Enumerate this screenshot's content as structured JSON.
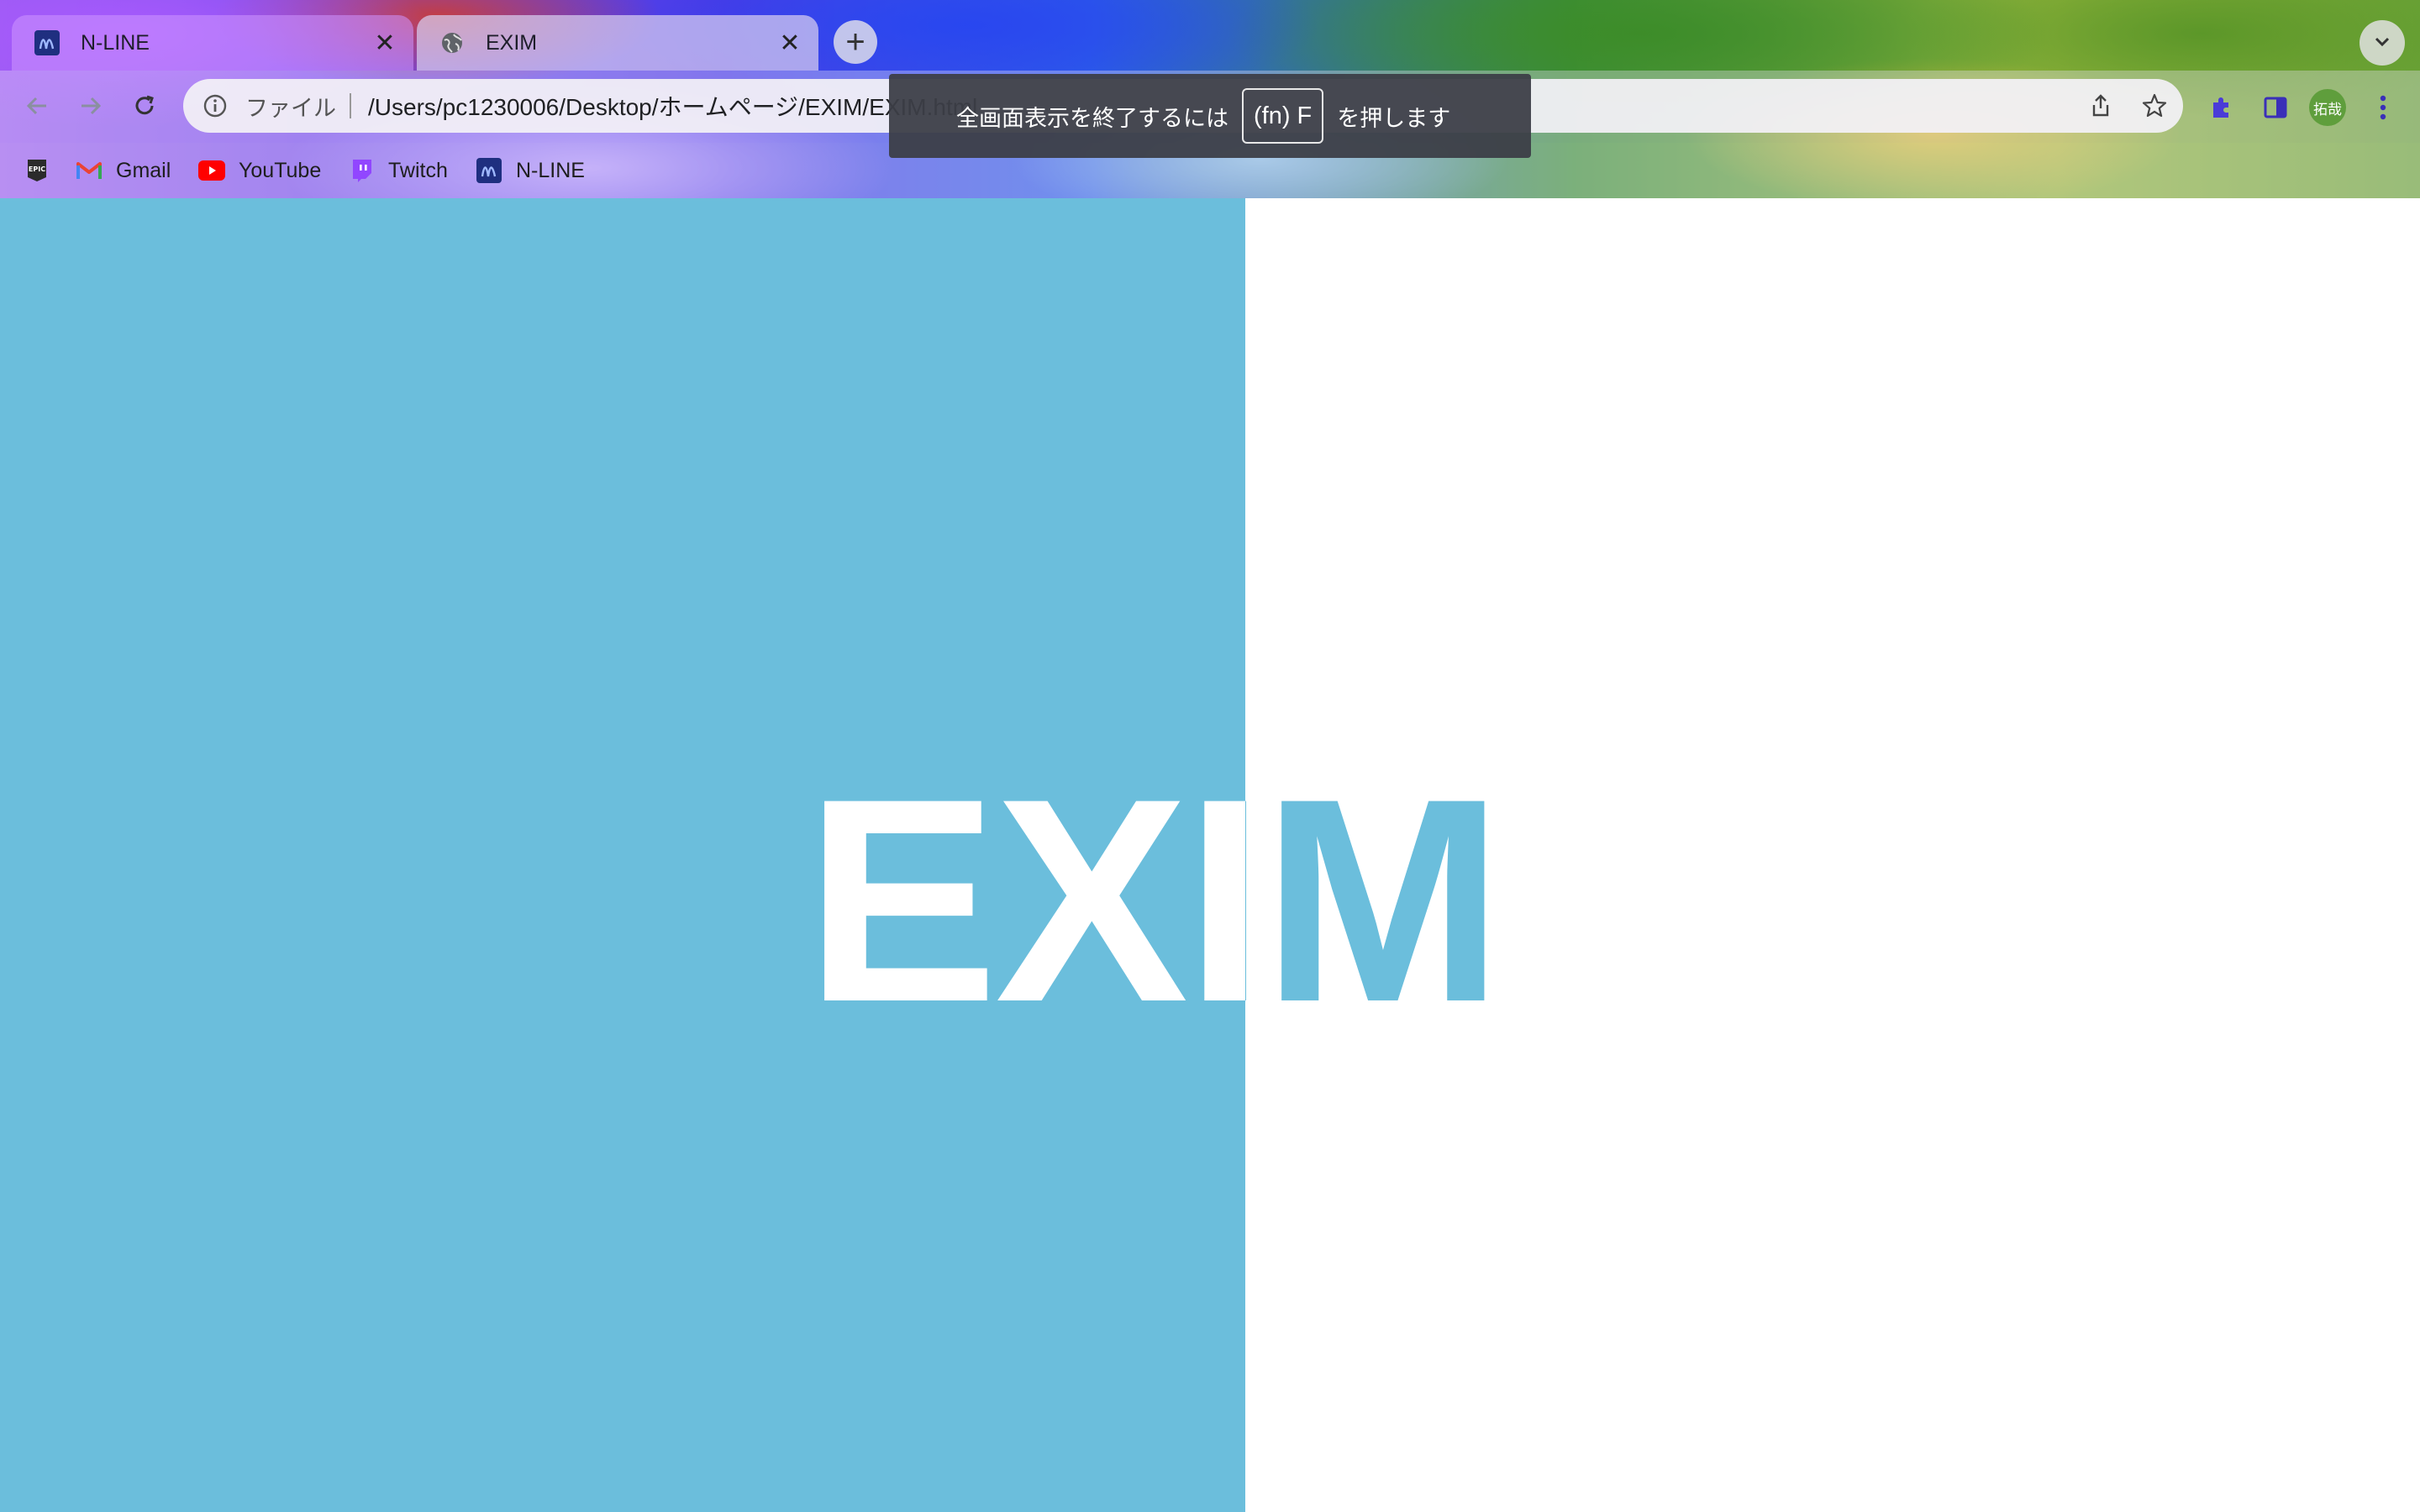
{
  "tabs": [
    {
      "title": "N-LINE",
      "favicon": "n-line-icon",
      "close": "✕"
    },
    {
      "title": "EXIM",
      "favicon": "globe-icon",
      "close": "✕"
    }
  ],
  "new_tab_label": "+",
  "omnibox": {
    "scheme_label": "ファイル",
    "url": "/Users/pc1230006/Desktop/ホームページ/EXIM/EXIM.html"
  },
  "profile": {
    "avatar_text": "拓哉",
    "color": "#5f9e3c"
  },
  "bookmarks": [
    {
      "label": "",
      "icon": "epic-games-icon"
    },
    {
      "label": "Gmail",
      "icon": "gmail-icon"
    },
    {
      "label": "YouTube",
      "icon": "youtube-icon"
    },
    {
      "label": "Twitch",
      "icon": "twitch-icon"
    },
    {
      "label": "N-LINE",
      "icon": "n-line-icon"
    }
  ],
  "fullscreen_toast": {
    "text_before": "全画面表示を終了するには",
    "key": "(fn) F",
    "text_after": "を押します"
  },
  "page": {
    "logo_text": "EXIM",
    "colors": {
      "panel": "#6bbedc",
      "background": "#ffffff"
    }
  }
}
